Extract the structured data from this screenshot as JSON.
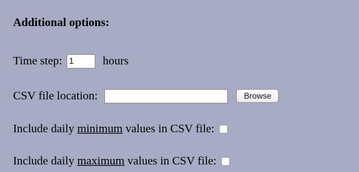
{
  "section": {
    "title": "Additional options:"
  },
  "time_step": {
    "label": "Time step:",
    "value": "1",
    "unit": "hours"
  },
  "csv_location": {
    "label": "CSV file location:",
    "value": "",
    "button_label": "Browse"
  },
  "include_min": {
    "prefix": "Include daily ",
    "emphasis": "minimum",
    "suffix": " values in CSV file:",
    "checked": false
  },
  "include_max": {
    "prefix": "Include daily ",
    "emphasis": "maximum",
    "suffix": " values in CSV file:",
    "checked": false
  }
}
